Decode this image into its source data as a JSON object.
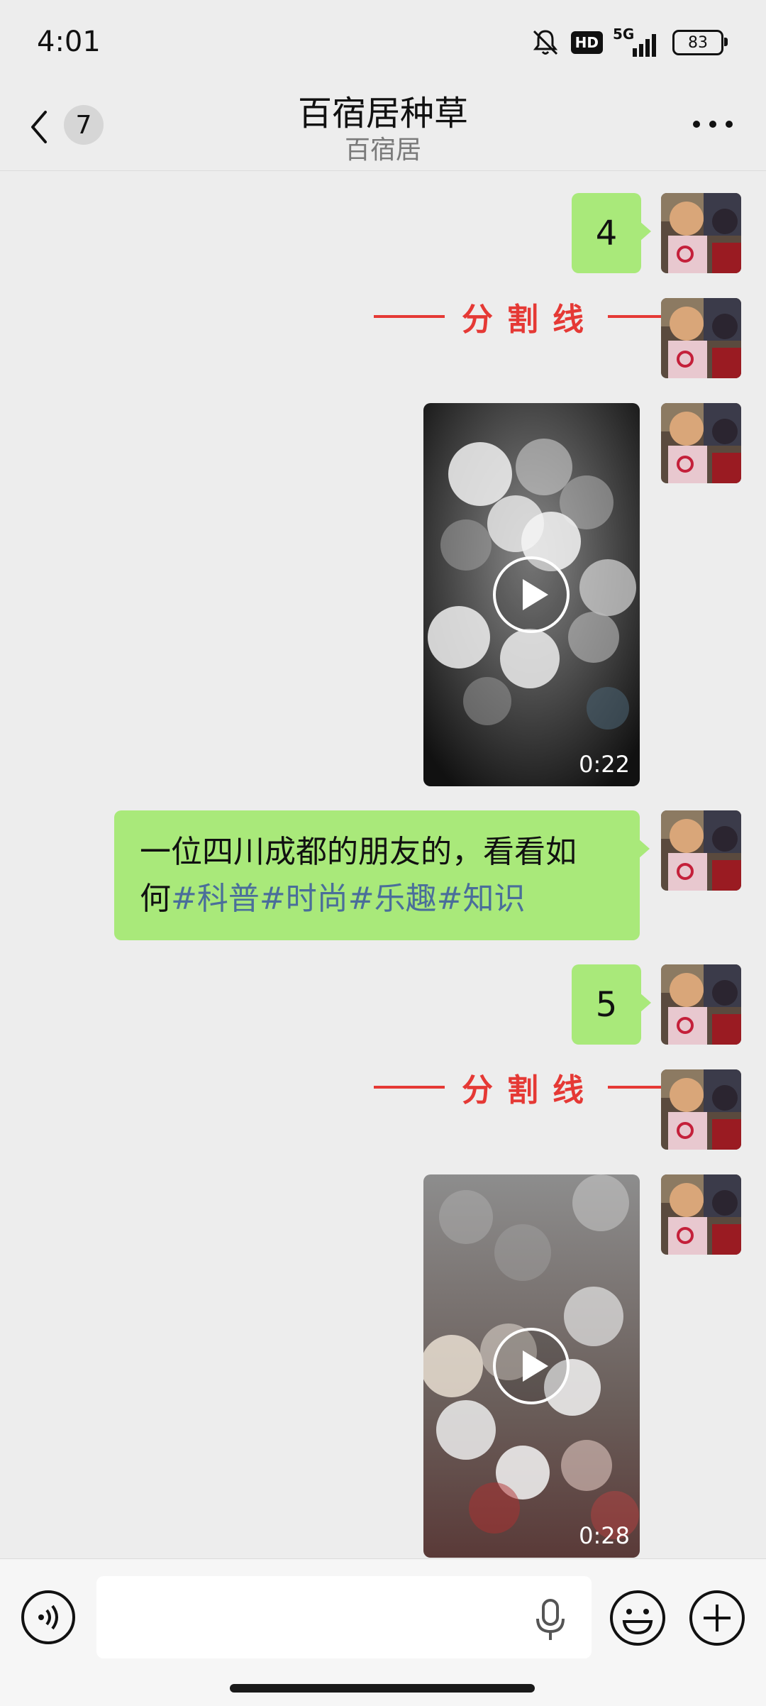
{
  "status_bar": {
    "time": "4:01",
    "hd_label": "HD",
    "network_label": "5G",
    "battery": "83"
  },
  "header": {
    "unread_count": "7",
    "title": "百宿居种草",
    "subtitle": "百宿居"
  },
  "messages": {
    "m1": "4",
    "divider1": "分割线",
    "video1_duration": "0:22",
    "text_body_line1": "一位四川成都的朋友的，看看如",
    "text_body_line2_prefix": "何",
    "text_tags": "#科普#时尚#乐趣#知识",
    "m2": "5",
    "divider2": "分割线",
    "video2_duration": "0:28"
  },
  "input_bar": {
    "placeholder": ""
  },
  "colors": {
    "bubble": "#a9e97a",
    "divider": "#e53935",
    "hashtag": "#4a6e9a",
    "background": "#ededed"
  },
  "icons": [
    "back-chevron-icon",
    "more-icon",
    "voice-icon",
    "mic-icon",
    "emoji-icon",
    "plus-icon",
    "play-icon",
    "mute-icon",
    "signal-icon"
  ]
}
